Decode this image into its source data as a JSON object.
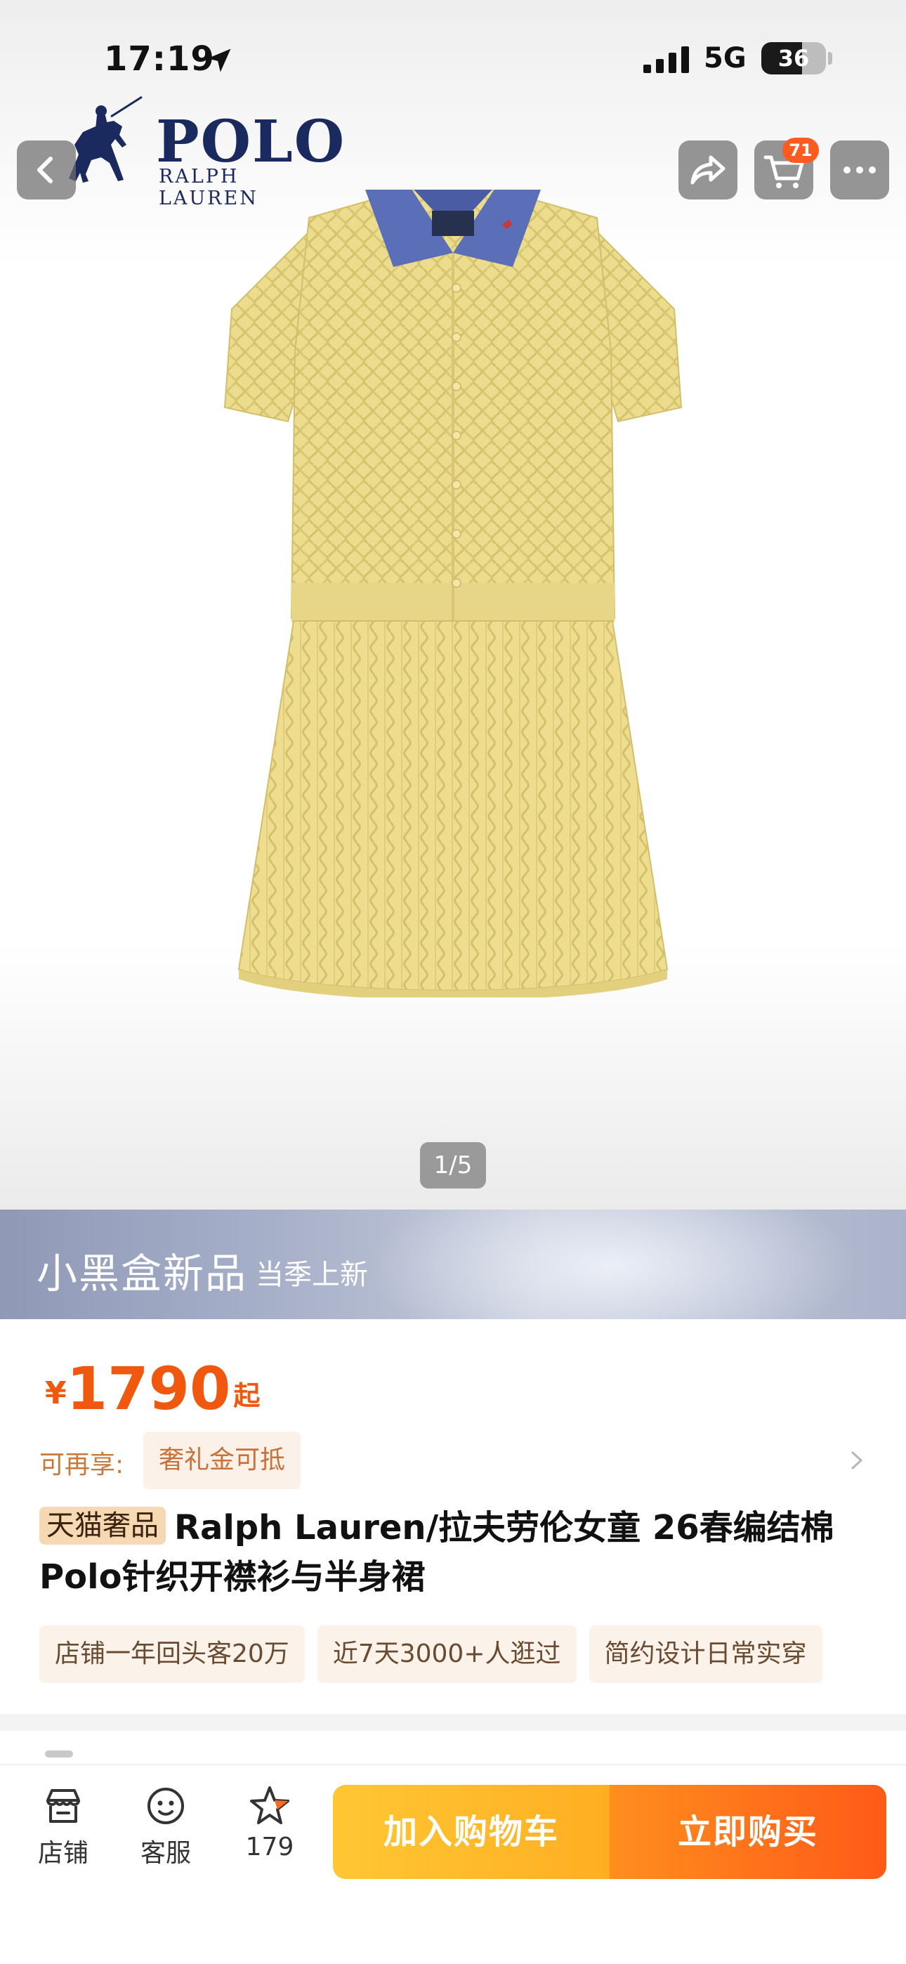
{
  "status_bar": {
    "time": "17:19",
    "network": "5G",
    "battery": "36"
  },
  "brand": {
    "name": "POLO",
    "subname": "RALPH LAUREN"
  },
  "nav": {
    "back_icon": "chevron-left-icon",
    "share_icon": "share-icon",
    "cart_icon": "cart-icon",
    "cart_badge": "71",
    "more_icon": "more-icon"
  },
  "gallery": {
    "pager": "1/5"
  },
  "banner": {
    "title": "小黑盒新品",
    "subtitle": "当季上新"
  },
  "product": {
    "currency": "¥",
    "price": "1790",
    "price_suffix": "起",
    "perk_label": "可再享:",
    "perk_chip": "奢礼金可抵",
    "badge": "天猫奢品",
    "title": "Ralph Lauren/拉夫劳伦女童 26春编结棉Polo针织开襟衫与半身裙",
    "tags": [
      "店铺一年回头客20万",
      "近7天3000+人逛过",
      "简约设计日常实穿"
    ]
  },
  "bottom_bar": {
    "store_label": "店铺",
    "service_label": "客服",
    "fav_count": "179",
    "add_to_cart": "加入购物车",
    "buy_now": "立即购买"
  },
  "colors": {
    "accent_orange": "#f0580f",
    "add_cart_start": "#ffc733",
    "buy_now_end": "#ff5a18",
    "brand_navy": "#1b2a5e"
  }
}
